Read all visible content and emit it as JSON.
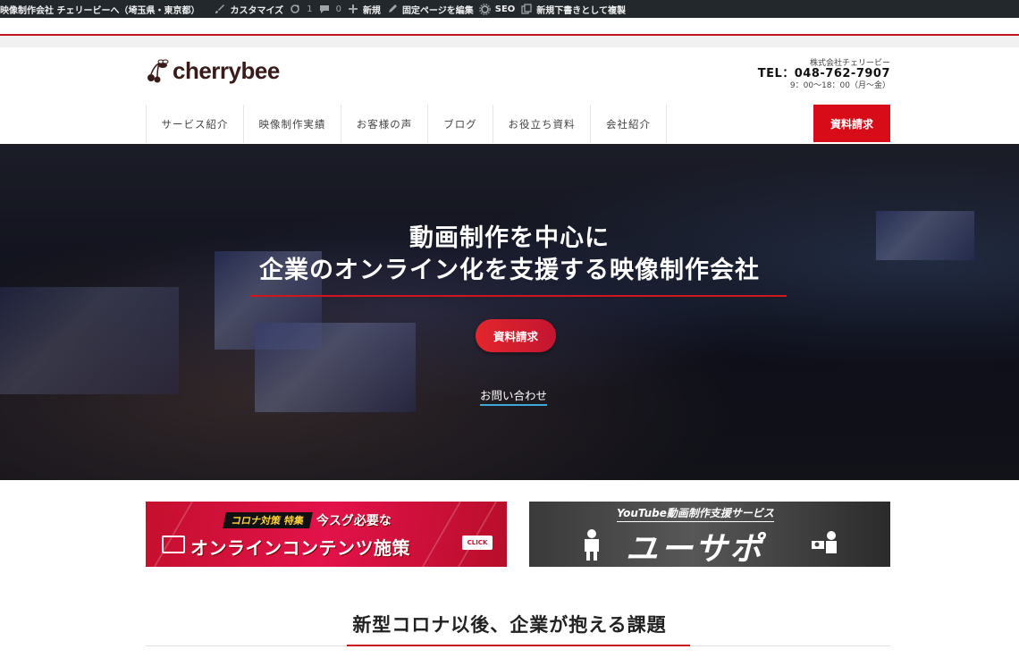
{
  "adminbar": {
    "site": "映像制作会社 チェリービーへ（埼玉県・東京都）",
    "customize": "カスタマイズ",
    "updates_count": "1",
    "comments_count": "0",
    "new": "新規",
    "edit_page": "固定ページを編集",
    "seo": "SEO",
    "duplicate": "新規下書きとして複製"
  },
  "header": {
    "logo_text": "cherrybee",
    "company": "株式会社チェリービー",
    "tel": "TEL：048-762-7907",
    "hours": "9：00〜18：00（月〜金）"
  },
  "nav": {
    "items": [
      "サービス紹介",
      "映像制作実績",
      "お客様の声",
      "ブログ",
      "お役立ち資料",
      "会社紹介"
    ],
    "request_button": "資料請求"
  },
  "hero": {
    "line1": "動画制作を中心に",
    "line2": "企業のオンライン化を支援する映像制作会社",
    "cta": "資料請求",
    "inquiry": "お問い合わせ"
  },
  "banner1": {
    "tag": "コロナ対策 特集",
    "tag2": "今スグ必要な",
    "main": "オンラインコンテンツ施策",
    "click": "CLICK"
  },
  "banner2": {
    "sub": "YouTube動画制作支援サービス",
    "main": "ユーサポ"
  },
  "section": {
    "title": "新型コロナ以後、企業が抱える課題"
  },
  "colors": {
    "accent_red": "#d80c18",
    "adminbar_bg": "#23282d"
  }
}
